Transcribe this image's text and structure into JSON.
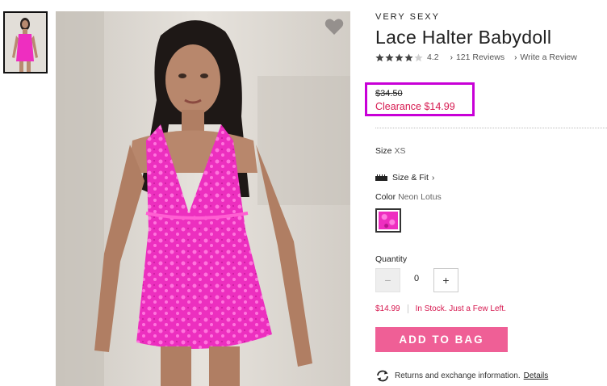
{
  "product": {
    "brand": "VERY SEXY",
    "title": "Lace Halter Babydoll",
    "rating": "4.2",
    "rating_fraction": 0.84,
    "reviews_link": "121 Reviews",
    "write_review_link": "Write a Review"
  },
  "pricing": {
    "original": "$34.50",
    "clearance": "Clearance $14.99",
    "highlight_color": "#c800d7",
    "sale_color": "#d6184f"
  },
  "options": {
    "size_label": "Size",
    "size_value": "XS",
    "size_fit_link": "Size & Fit",
    "color_label": "Color",
    "color_value": "Neon Lotus",
    "swatch_color": "#ee2ec0"
  },
  "quantity": {
    "label": "Quantity",
    "value": "0",
    "minus": "−",
    "plus": "+"
  },
  "stock": {
    "price": "$14.99",
    "status": "In Stock. Just a Few Left."
  },
  "cart": {
    "add_label": "ADD TO BAG",
    "button_color": "#ef5f96"
  },
  "returns": {
    "text": "Returns and exchange information.",
    "details_link": "Details"
  },
  "icons": {
    "wishlist": "heart-icon",
    "size_fit": "ruler-icon",
    "returns": "exchange-arrows-icon",
    "chevron": "chevron-right-icon"
  }
}
